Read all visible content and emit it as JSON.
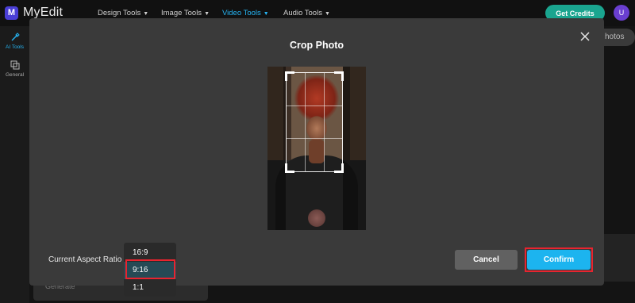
{
  "app": {
    "logo_letter": "M",
    "name": "MyEdit"
  },
  "nav": [
    {
      "label": "Design Tools",
      "active": false
    },
    {
      "label": "Image Tools",
      "active": false
    },
    {
      "label": "Video Tools",
      "active": true
    },
    {
      "label": "Audio Tools",
      "active": false
    }
  ],
  "header": {
    "credits_label": "Get Credits",
    "avatar_initial": "U"
  },
  "sidebar": {
    "items": [
      {
        "label": "AI Tools",
        "icon": "magic-wand-icon",
        "active": true
      },
      {
        "label": "General",
        "icon": "layers-icon",
        "active": false
      }
    ]
  },
  "background": {
    "photos_chip": "hotos",
    "generate_label": "Generate"
  },
  "modal": {
    "title": "Crop Photo",
    "aspect_label": "Current Aspect Ratio",
    "ratio_options": [
      "16:9",
      "9:16",
      "1:1"
    ],
    "selected_ratio": "9:16",
    "cancel_label": "Cancel",
    "confirm_label": "Confirm"
  },
  "colors": {
    "accent": "#1cb4ef",
    "credits": "#1aa58f",
    "highlight": "#e8242f"
  }
}
